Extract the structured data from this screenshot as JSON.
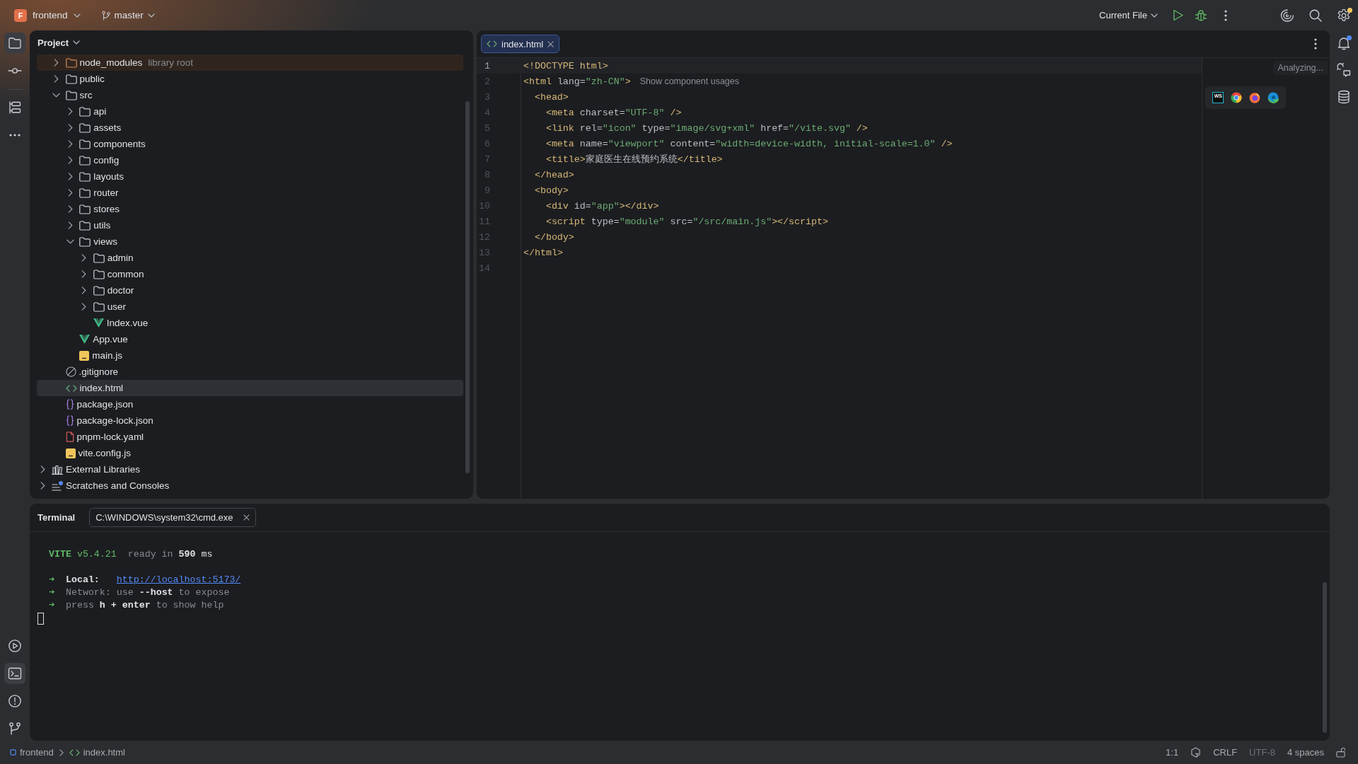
{
  "title_bar": {
    "project_initial": "F",
    "project_name": "frontend",
    "branch": "master",
    "run_configuration": "Current File",
    "settings_badge": true
  },
  "left_toolbar": {
    "top": [
      {
        "kind": "project",
        "selected": true
      },
      {
        "kind": "commit",
        "selected": false
      },
      {
        "kind": "structure",
        "selected": false
      },
      {
        "kind": "more",
        "selected": false
      }
    ],
    "bottom": [
      {
        "kind": "services",
        "selected": false
      },
      {
        "kind": "terminal",
        "selected": true
      },
      {
        "kind": "problems",
        "selected": false
      },
      {
        "kind": "git",
        "selected": false
      }
    ]
  },
  "right_toolbar": {
    "notifications_badge": true
  },
  "project": {
    "title": "Project",
    "items": [
      {
        "kind": "library-folder",
        "label": "node_modules",
        "suffix": "library root",
        "expanded": false,
        "selected": false
      },
      {
        "kind": "folder",
        "label": "public",
        "expanded": false,
        "selected": false
      },
      {
        "kind": "folder",
        "label": "src",
        "expanded": true,
        "selected": false,
        "children": [
          {
            "kind": "folder",
            "label": "api",
            "expanded": false,
            "selected": false
          },
          {
            "kind": "folder",
            "label": "assets",
            "expanded": false,
            "selected": false
          },
          {
            "kind": "folder",
            "label": "components",
            "expanded": false,
            "selected": false
          },
          {
            "kind": "folder",
            "label": "config",
            "expanded": false,
            "selected": false
          },
          {
            "kind": "folder",
            "label": "layouts",
            "expanded": false,
            "selected": false
          },
          {
            "kind": "folder",
            "label": "router",
            "expanded": false,
            "selected": false
          },
          {
            "kind": "folder",
            "label": "stores",
            "expanded": false,
            "selected": false
          },
          {
            "kind": "folder",
            "label": "utils",
            "expanded": false,
            "selected": false
          },
          {
            "kind": "folder",
            "label": "views",
            "expanded": true,
            "selected": false,
            "children": [
              {
                "kind": "folder",
                "label": "admin",
                "expanded": false,
                "selected": false
              },
              {
                "kind": "folder",
                "label": "common",
                "expanded": false,
                "selected": false
              },
              {
                "kind": "folder",
                "label": "doctor",
                "expanded": false,
                "selected": false
              },
              {
                "kind": "folder",
                "label": "user",
                "expanded": false,
                "selected": false
              },
              {
                "kind": "vue",
                "label": "Index.vue",
                "selected": false
              }
            ]
          },
          {
            "kind": "vue",
            "label": "App.vue",
            "selected": false
          },
          {
            "kind": "js",
            "label": "main.js",
            "selected": false
          }
        ]
      },
      {
        "kind": "ignore",
        "label": ".gitignore",
        "selected": false
      },
      {
        "kind": "html",
        "label": "index.html",
        "selected": true
      },
      {
        "kind": "json",
        "label": "package.json",
        "selected": false
      },
      {
        "kind": "json",
        "label": "package-lock.json",
        "selected": false
      },
      {
        "kind": "yaml",
        "label": "pnpm-lock.yaml",
        "selected": false
      },
      {
        "kind": "js",
        "label": "vite.config.js",
        "selected": false
      }
    ],
    "extra_items": [
      {
        "kind": "libraries",
        "label": "External Libraries",
        "expanded": false,
        "selected": false
      },
      {
        "kind": "scratches",
        "label": "Scratches and Consoles",
        "expanded": false,
        "selected": false
      }
    ]
  },
  "editor": {
    "tabs": [
      {
        "kind": "html",
        "label": "index.html",
        "selected": true
      }
    ],
    "status": "Analyzing...",
    "lines": [
      {
        "number": "1",
        "current": true,
        "code": [
          {
            "kind": "tag",
            "text": "<!DOCTYPE html>"
          }
        ]
      },
      {
        "number": "2",
        "current": false,
        "code": [
          {
            "kind": "tag",
            "text": "<html"
          },
          {
            "kind": "attr",
            "text": " lang="
          },
          {
            "kind": "value",
            "text": "\"zh-CN\""
          },
          {
            "kind": "tag",
            "text": ">"
          }
        ],
        "hint": "Show component usages"
      },
      {
        "number": "3",
        "current": false,
        "code": [
          {
            "kind": "tag",
            "text": "  <head>"
          }
        ]
      },
      {
        "number": "4",
        "current": false,
        "code": [
          {
            "kind": "tag",
            "text": "    <meta"
          },
          {
            "kind": "attr",
            "text": " charset="
          },
          {
            "kind": "value",
            "text": "\"UTF-8\""
          },
          {
            "kind": "tag",
            "text": " />"
          }
        ]
      },
      {
        "number": "5",
        "current": false,
        "code": [
          {
            "kind": "tag",
            "text": "    <link"
          },
          {
            "kind": "attr",
            "text": " rel="
          },
          {
            "kind": "value",
            "text": "\"icon\""
          },
          {
            "kind": "attr",
            "text": " type="
          },
          {
            "kind": "value",
            "text": "\"image/svg+xml\""
          },
          {
            "kind": "attr",
            "text": " href="
          },
          {
            "kind": "value",
            "text": "\"/vite.svg\""
          },
          {
            "kind": "tag",
            "text": " />"
          }
        ]
      },
      {
        "number": "6",
        "current": false,
        "code": [
          {
            "kind": "tag",
            "text": "    <meta"
          },
          {
            "kind": "attr",
            "text": " name="
          },
          {
            "kind": "value",
            "text": "\"viewport\""
          },
          {
            "kind": "attr",
            "text": " content="
          },
          {
            "kind": "value",
            "text": "\"width=device-width, initial-scale=1.0\""
          },
          {
            "kind": "tag",
            "text": " />"
          }
        ]
      },
      {
        "number": "7",
        "current": false,
        "code": [
          {
            "kind": "tag",
            "text": "    <title>"
          },
          {
            "kind": "text",
            "text": "家庭医生在线预约系统"
          },
          {
            "kind": "tag",
            "text": "</title>"
          }
        ]
      },
      {
        "number": "8",
        "current": false,
        "code": [
          {
            "kind": "tag",
            "text": "  </head>"
          }
        ]
      },
      {
        "number": "9",
        "current": false,
        "code": [
          {
            "kind": "tag",
            "text": "  <body>"
          }
        ]
      },
      {
        "number": "10",
        "current": false,
        "code": [
          {
            "kind": "tag",
            "text": "    <div"
          },
          {
            "kind": "attr",
            "text": " id="
          },
          {
            "kind": "value",
            "text": "\"app\""
          },
          {
            "kind": "tag",
            "text": "></div>"
          }
        ]
      },
      {
        "number": "11",
        "current": false,
        "code": [
          {
            "kind": "tag",
            "text": "    <script"
          },
          {
            "kind": "attr",
            "text": " type="
          },
          {
            "kind": "value",
            "text": "\"module\""
          },
          {
            "kind": "attr",
            "text": " src="
          },
          {
            "kind": "value",
            "text": "\"/src/main.js\""
          },
          {
            "kind": "tag",
            "text": "></script>"
          }
        ]
      },
      {
        "number": "12",
        "current": false,
        "code": [
          {
            "kind": "tag",
            "text": "  </body>"
          }
        ]
      },
      {
        "number": "13",
        "current": false,
        "code": [
          {
            "kind": "tag",
            "text": "</html>"
          }
        ]
      },
      {
        "number": "14",
        "current": false
      }
    ],
    "preview": [
      {
        "kind": "ide",
        "label": "WS"
      },
      {
        "kind": "chrome"
      },
      {
        "kind": "firefox"
      },
      {
        "kind": "edge"
      }
    ]
  },
  "terminal": {
    "title": "Terminal",
    "tabs": [
      {
        "label": "C:\\WINDOWS\\system32\\cmd.exe",
        "selected": true
      }
    ],
    "output": [
      {
        "lines": [
          {
            "segments": [
              {
                "kind": "brand",
                "text": "VITE"
              },
              {
                "kind": "version",
                "text": " v5.4.21"
              },
              {
                "kind": "dim",
                "text": "  ready in "
              },
              {
                "kind": "strong",
                "text": "590"
              },
              {
                "kind": "plain",
                "text": " ms"
              }
            ]
          }
        ]
      },
      {
        "lines": [
          {
            "segments": [
              {
                "kind": "arrow",
                "text": "➜"
              },
              {
                "kind": "strong",
                "text": "  Local:   "
              },
              {
                "kind": "link",
                "text": "http://localhost:5173/"
              }
            ]
          },
          {
            "segments": [
              {
                "kind": "arrow",
                "text": "➜"
              },
              {
                "kind": "dim",
                "text": "  Network: use "
              },
              {
                "kind": "strong",
                "text": "--host"
              },
              {
                "kind": "dim",
                "text": " to expose"
              }
            ]
          },
          {
            "segments": [
              {
                "kind": "arrow",
                "text": "➜"
              },
              {
                "kind": "dim",
                "text": "  press "
              },
              {
                "kind": "strong",
                "text": "h + enter"
              },
              {
                "kind": "dim",
                "text": " to show help"
              }
            ]
          }
        ]
      }
    ]
  },
  "status_bar": {
    "breadcrumbs": [
      {
        "kind": "module",
        "label": "frontend"
      },
      {
        "kind": "html",
        "label": "index.html"
      }
    ],
    "widgets": [
      {
        "label": "1:1",
        "disabled": false
      },
      {
        "label": "CRLF",
        "disabled": false
      },
      {
        "label": "UTF-8",
        "disabled": true
      },
      {
        "label": "4 spaces",
        "disabled": false
      }
    ]
  }
}
